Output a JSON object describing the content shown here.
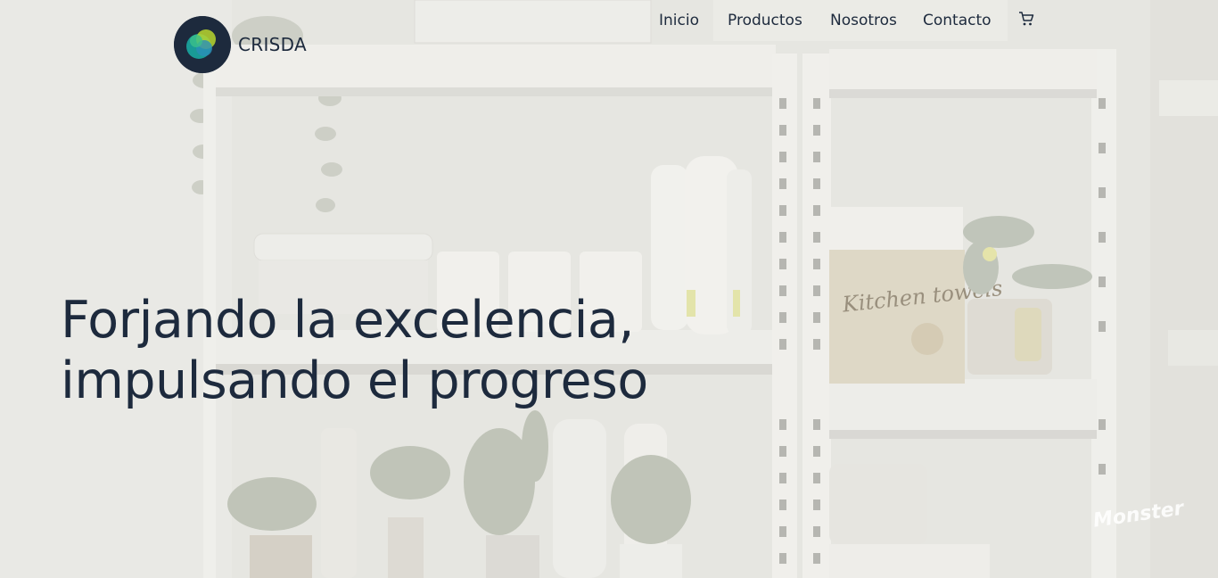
{
  "brand": {
    "name": "CRISDA"
  },
  "nav": {
    "items": [
      {
        "label": "Inicio"
      },
      {
        "label": "Productos"
      },
      {
        "label": "Nosotros"
      },
      {
        "label": "Contacto"
      }
    ],
    "cart_icon": "shopping-cart-icon"
  },
  "hero": {
    "headline_line1": "Forjando la excelencia,",
    "headline_line2": "impulsando el progreso",
    "background": "white metal shelves with plants and household products"
  },
  "labels": {
    "kitchen_towels": "Kitchen towels",
    "watermark": "Monster"
  },
  "colors": {
    "text_primary": "#1d2a3d",
    "overlay": "#ebeae6",
    "logo_bg": "#1d2a3d",
    "logo_teal": "#1aa7a0",
    "logo_green": "#b8d62e"
  }
}
